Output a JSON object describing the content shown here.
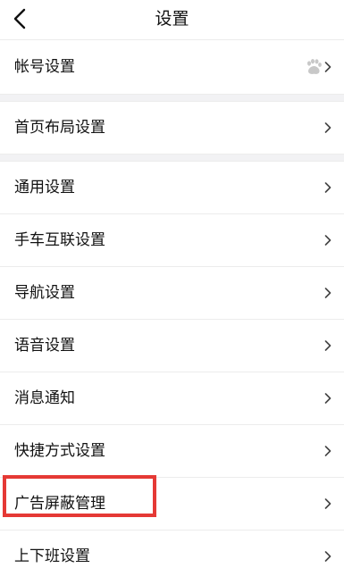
{
  "header": {
    "title": "设置",
    "back_icon": "chevron-left-icon"
  },
  "account": {
    "label": "帐号设置",
    "badge_icon": "baidu-paw-icon",
    "chevron_icon": "chevron-right-icon"
  },
  "home_layout": {
    "label": "首页布局设置",
    "chevron_icon": "chevron-right-icon"
  },
  "settings": {
    "items": [
      {
        "label": "通用设置"
      },
      {
        "label": "手车互联设置"
      },
      {
        "label": "导航设置"
      },
      {
        "label": "语音设置"
      },
      {
        "label": "消息通知"
      },
      {
        "label": "快捷方式设置"
      },
      {
        "label": "广告屏蔽管理",
        "highlighted": true
      },
      {
        "label": "上下班设置"
      }
    ]
  },
  "colors": {
    "background": "#ffffff",
    "section_gap": "#f2f2f4",
    "divider": "#ececec",
    "text": "#111111",
    "chevron": "#666666",
    "paw_icon": "#c8c8c8",
    "highlight_border": "#e53935"
  }
}
